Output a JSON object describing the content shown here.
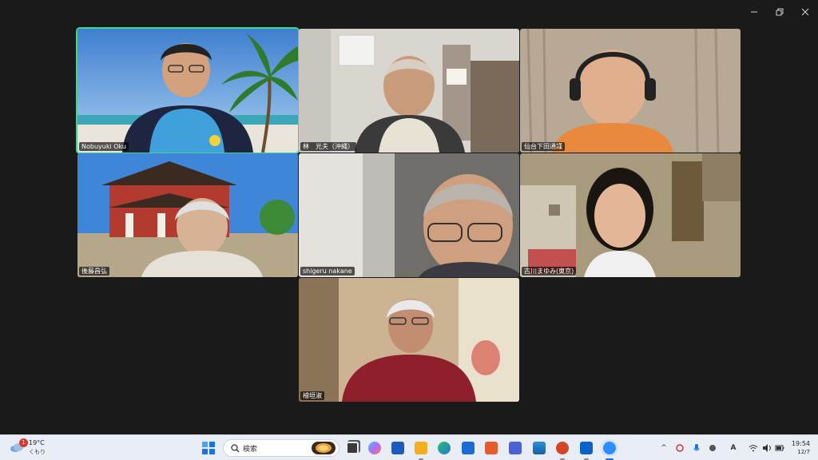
{
  "window": {
    "controls": {
      "minimize": "minimize-icon",
      "restore": "restore-icon",
      "close": "close-icon"
    }
  },
  "participants": [
    {
      "name": "Nobuyuki Oku",
      "active": true
    },
    {
      "name": "林　光夫（沖縄）",
      "active": false
    },
    {
      "name": "仙台下田通謹",
      "active": false
    },
    {
      "name": "後藤昌弘",
      "active": false
    },
    {
      "name": "shigeru nakane",
      "active": false
    },
    {
      "name": "古川まゆみ(東京)",
      "active": false
    },
    {
      "name": "檜垣淑",
      "active": false
    }
  ],
  "taskbar": {
    "weather": {
      "temp": "19°C",
      "condition": "くもり",
      "badge": "1",
      "icon": "cloud-icon"
    },
    "search": {
      "placeholder": "検索"
    },
    "apps": [
      "task-view-icon",
      "copilot-icon",
      "word-icon",
      "file-explorer-icon",
      "edge-icon",
      "store-icon",
      "app-icon",
      "app-icon",
      "photos-icon",
      "powerpoint-icon",
      "outlook-icon",
      "zoom-icon"
    ],
    "tray": {
      "chevron": "^",
      "ime": "A"
    },
    "clock": {
      "time": "19:54",
      "date": "12/7"
    }
  },
  "colors": {
    "active_speaker_border": "#3fd68e",
    "background": "#1a1a1a",
    "taskbar": "#e9eef6"
  }
}
